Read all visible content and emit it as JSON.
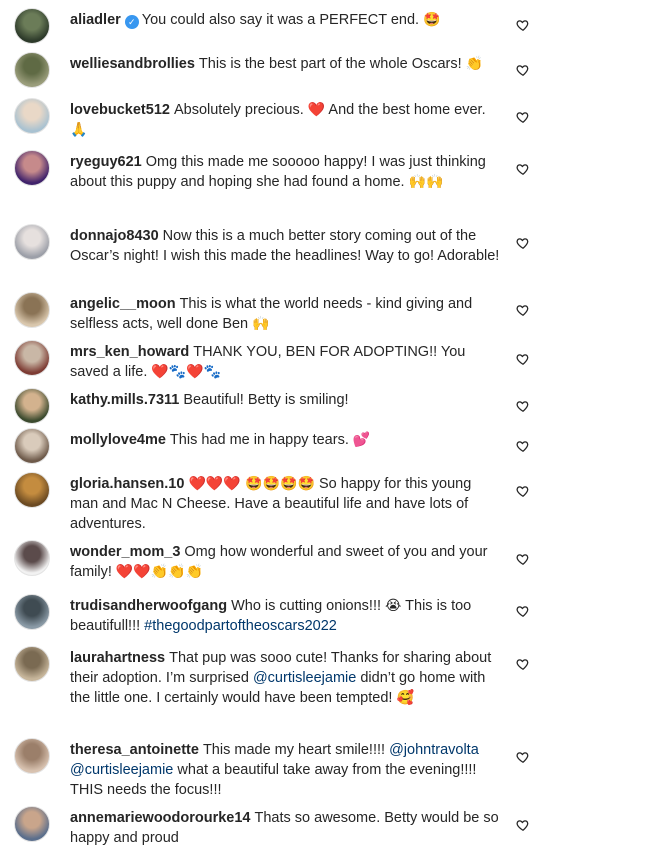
{
  "comments": [
    {
      "user": "aliadler",
      "verified": true,
      "parts": [
        {
          "t": "You could also say it was a PERFECT end. "
        },
        {
          "e": "🤩"
        }
      ],
      "avatar": [
        "#2d3a2a",
        "#6b7c58"
      ]
    },
    {
      "user": "welliesandbrollies",
      "parts": [
        {
          "t": "This is the best part of the whole Oscars! "
        },
        {
          "e": "👏"
        }
      ],
      "avatar": [
        "#9a9d7b",
        "#5f6a44"
      ]
    },
    {
      "user": "lovebucket512",
      "parts": [
        {
          "t": "Absolutely precious. "
        },
        {
          "e": "❤️"
        },
        {
          "t": " And the best home ever. "
        },
        {
          "e": "🙏"
        }
      ],
      "avatar": [
        "#a9c2d1",
        "#e9d8c7"
      ]
    },
    {
      "user": "ryeguy621",
      "parts": [
        {
          "t": "Omg this made me sooooo happy! I was just thinking about this puppy and hoping she had found a home. "
        },
        {
          "e": "🙌🙌"
        }
      ],
      "avatar": [
        "#40226b",
        "#c68a8b"
      ]
    },
    {
      "user": "donnajo8430",
      "parts": [
        {
          "t": "Now this is a much better story coming out of the Oscar’s night! I wish this made the headlines! Way to go! Adorable!"
        }
      ],
      "avatar": [
        "#9c9fa8",
        "#e6e0de"
      ]
    },
    {
      "user": "angelic__moon",
      "parts": [
        {
          "t": "This is what the world needs - kind giving and selfless acts, well done Ben "
        },
        {
          "e": "🙌"
        }
      ],
      "avatar": [
        "#d9c7ad",
        "#8a7355"
      ]
    },
    {
      "user": "mrs_ken_howard",
      "parts": [
        {
          "t": "THANK YOU, BEN FOR ADOPTING!! You saved a life. "
        },
        {
          "e": "❤️🐾❤️🐾"
        }
      ],
      "avatar": [
        "#7d3b33",
        "#c9b7a6"
      ]
    },
    {
      "user": "kathy.mills.7311",
      "parts": [
        {
          "t": "Beautiful! Betty is smiling!"
        }
      ],
      "avatar": [
        "#3b4a2e",
        "#d3b28e"
      ]
    },
    {
      "user": "mollylove4me",
      "parts": [
        {
          "t": "This had me in happy tears. "
        },
        {
          "e": "💕"
        }
      ],
      "avatar": [
        "#6e5a4a",
        "#d9cbbb"
      ]
    },
    {
      "user": "gloria.hansen.10",
      "parts": [
        {
          "e": "❤️❤️❤️ 🤩🤩🤩🤩"
        },
        {
          "t": " So happy for this young man and Mac N Cheese. Have a beautiful life and have lots of adventures."
        }
      ],
      "avatar": [
        "#6b4a22",
        "#c48c3f"
      ]
    },
    {
      "user": "wonder_mom_3",
      "parts": [
        {
          "t": "Omg how wonderful and sweet of you and your family! "
        },
        {
          "e": "❤️❤️👏👏👏"
        }
      ],
      "avatar": [
        "#f2f2f2",
        "#5b4b4b"
      ]
    },
    {
      "user": "trudisandherwoofgang",
      "parts": [
        {
          "t": "Who is cutting onions!!! "
        },
        {
          "e": "😭"
        },
        {
          "t": " This is too beautifull!!! "
        },
        {
          "h": "#thegoodpartoftheoscars2022"
        }
      ],
      "avatar": [
        "#8a9aa6",
        "#3f4b52"
      ]
    },
    {
      "user": "laurahartness",
      "parts": [
        {
          "t": "That pup was sooo cute! Thanks for sharing about their adoption. I’m surprised "
        },
        {
          "m": "@curtisleejamie"
        },
        {
          "t": " didn’t go home with the little one. I certainly would have been tempted! "
        },
        {
          "e": "🥰"
        }
      ],
      "avatar": [
        "#c7b69b",
        "#7a6a52"
      ]
    },
    {
      "user": "theresa_antoinette",
      "parts": [
        {
          "t": "This made my heart smile!!!! "
        },
        {
          "m": "@johntravolta"
        },
        {
          "t": " "
        },
        {
          "m": "@curtisleejamie"
        },
        {
          "t": " what a beautiful take away from the evening!!!! THIS needs the focus!!!"
        }
      ],
      "avatar": [
        "#d8c2b0",
        "#9b7f6a"
      ]
    },
    {
      "user": "annemariewoodorourke14",
      "parts": [
        {
          "t": "Thats so awesome. Betty would be so happy and proud"
        }
      ],
      "avatar": [
        "#5a6e8c",
        "#c9a58b"
      ]
    }
  ],
  "colors": {
    "username": "#262626",
    "mention": "#00376b",
    "verified": "#3897f0",
    "heart_outline": "#262626"
  },
  "icons": {
    "like": "heart-outline-icon",
    "verified": "verified-badge-icon"
  }
}
